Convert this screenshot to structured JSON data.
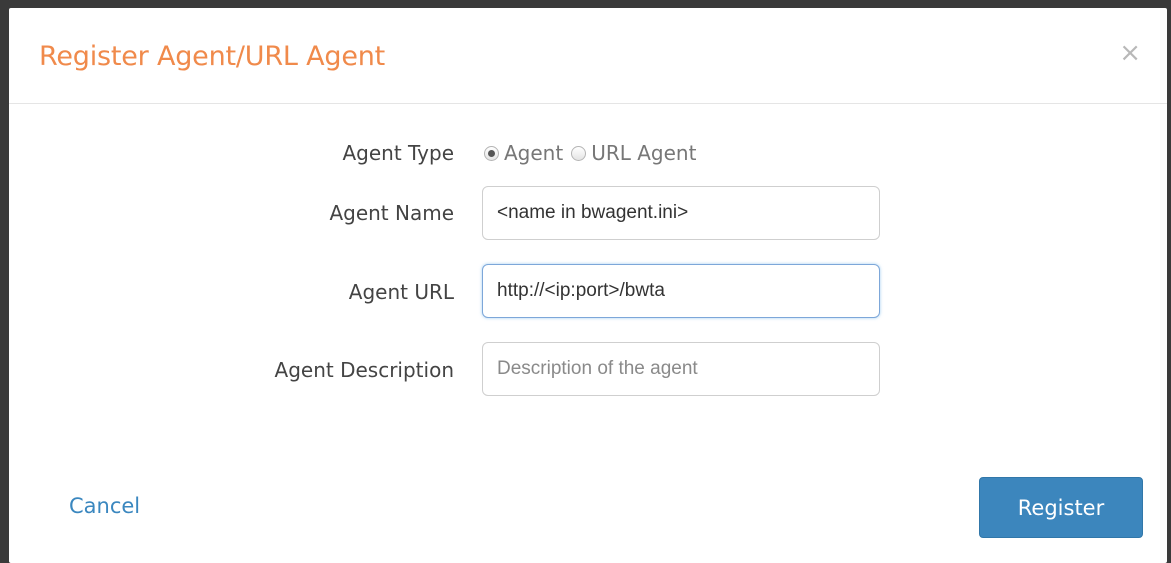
{
  "dialog": {
    "title": "Register Agent/URL Agent",
    "close_glyph": "×"
  },
  "form": {
    "agent_type": {
      "label": "Agent Type",
      "options": [
        {
          "label": "Agent",
          "selected": true
        },
        {
          "label": "URL Agent",
          "selected": false
        }
      ]
    },
    "agent_name": {
      "label": "Agent Name",
      "value": "<name in bwagent.ini>",
      "placeholder": ""
    },
    "agent_url": {
      "label": "Agent URL",
      "value": "http://<ip:port>/bwta",
      "placeholder": ""
    },
    "agent_description": {
      "label": "Agent Description",
      "value": "",
      "placeholder": "Description of the agent"
    }
  },
  "footer": {
    "cancel_label": "Cancel",
    "register_label": "Register"
  },
  "colors": {
    "title": "#f08a4b",
    "link": "#3a87bf",
    "primary_button": "#3c86bd"
  }
}
